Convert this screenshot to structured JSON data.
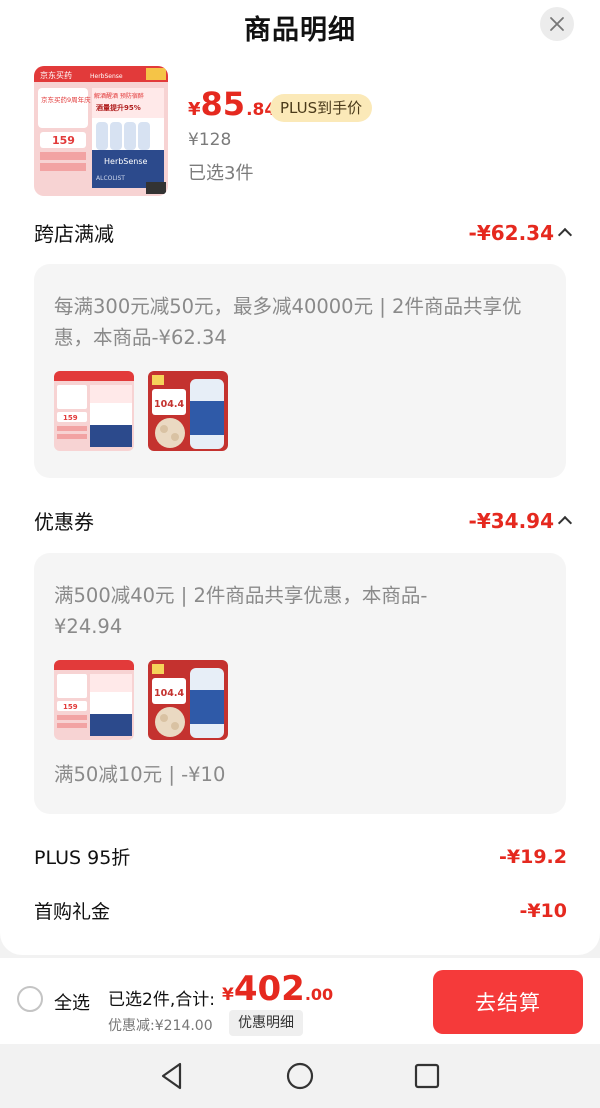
{
  "sheet": {
    "title": "商品明细"
  },
  "product": {
    "price_symbol": "¥",
    "price_integer": "85",
    "price_decimal": ".84",
    "plus_tag": "PLUS到手价",
    "original_price": "¥128",
    "selected_count": "已选3件",
    "image_text": {
      "brand1": "京东买药",
      "brand2": "HerbSense",
      "anniv": "京东买药9周年庆",
      "slogan": "解酒醒酒 预防宿醉",
      "boost": "酒量提升95%",
      "box_brand": "HerbSense",
      "box_name": "ALCOLIST",
      "price": "159"
    }
  },
  "cross_store": {
    "title": "跨店满减",
    "amount": "-¥62.34",
    "description": "每满300元减50元，最多减40000元 | 2件商品共享优惠，本商品-¥62.34"
  },
  "coupon": {
    "title": "优惠券",
    "amount": "-¥34.94",
    "description": "满500减40元 | 2件商品共享优惠，本商品-¥24.94",
    "extra": "满50减10元 | -¥10"
  },
  "thumb2_text": {
    "price": "104.4"
  },
  "plus_discount": {
    "label": "PLUS 95折",
    "value": "-¥19.2"
  },
  "first_gift": {
    "label": "首购礼金",
    "value": "-¥10"
  },
  "bottom": {
    "select_all": "全选",
    "total_label": "已选2件,合计:",
    "total_symbol": "¥",
    "total_integer": "402",
    "total_decimal": ".00",
    "discount_label": "优惠减:¥214.00",
    "discount_detail": "优惠明细",
    "checkout": "去结算"
  },
  "colors": {
    "accent": "#e5291f",
    "checkout": "#f53a3a",
    "plus_tag_bg": "#fbe9b8"
  }
}
